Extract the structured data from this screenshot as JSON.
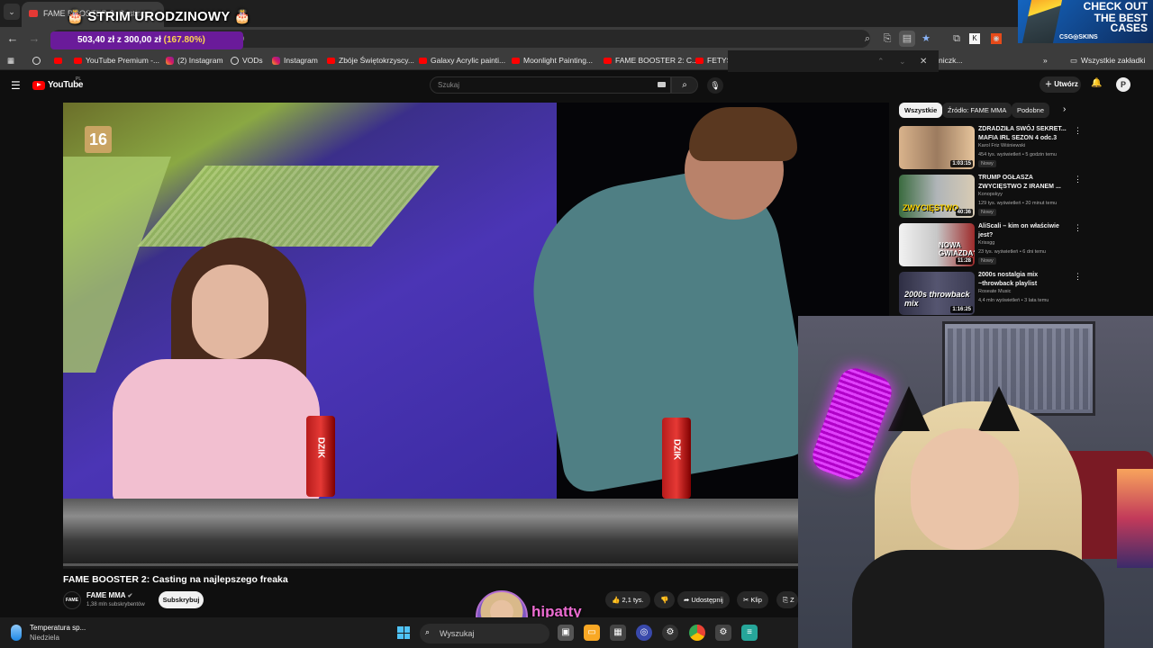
{
  "browser": {
    "active_tab_title": "FAME BOOSTER 2: Casting",
    "bookmarks": [
      {
        "label": "YouTube Premium -...",
        "icon": "youtube-icon"
      },
      {
        "label": "(2) Instagram",
        "icon": "instagram-icon"
      },
      {
        "label": "VODs",
        "icon": "globe-icon"
      },
      {
        "label": "Instagram",
        "icon": "instagram-icon"
      },
      {
        "label": "Zbóje Świętokrzyscy...",
        "icon": "youtube-icon"
      },
      {
        "label": "Galaxy Acrylic painti...",
        "icon": "youtube-icon"
      },
      {
        "label": "Moonlight Painting...",
        "icon": "youtube-icon"
      },
      {
        "label": "FAME BOOSTER 2: C...",
        "icon": "youtube-icon"
      },
      {
        "label": "FETYS",
        "icon": "youtube-icon"
      }
    ],
    "bookmark_partial_right": "niczk...",
    "all_bookmarks_label": "Wszystkie zakładki",
    "url_fragment": "0"
  },
  "stream_overlay": {
    "title": "🎂 STRIM URODZINOWY 🎂",
    "donation_current": "503,40 zł",
    "donation_sep": " z ",
    "donation_goal": "300,00 zł",
    "donation_pct": "(167.80%)",
    "ad_line1": "CHECK OUT",
    "ad_line2": "THE BEST",
    "ad_line3": "CASES",
    "ad_brand": "CSG◎SKINS",
    "streamer_name": "hipatty"
  },
  "youtube": {
    "logo_text": "YouTube",
    "region": "PL",
    "search_placeholder": "Szukaj",
    "create_label": "Utwórz",
    "avatar_letter": "P"
  },
  "video": {
    "rating_badge": "16",
    "can_label": "DZIK",
    "progress": 0.0,
    "title": "FAME BOOSTER 2: Casting na najlepszego freaka",
    "channel_name": "FAME MMA",
    "channel_logo": "FAME",
    "subscribers": "1,38 mln subskrybentów",
    "subscribe_label": "Subskrybuj",
    "likes": "2,1 tys.",
    "share_label": "Udostępnij",
    "clip_label": "Klip",
    "partial_label": "Z"
  },
  "sidebar": {
    "chips": [
      "Wszystkie",
      "Źródło: FAME MMA",
      "Podobne"
    ],
    "recommendations": [
      {
        "title": "ZDRADZIŁA SWÓJ SEKRET... MAFIA IRL SEZON 4 odc.3",
        "channel": "Karol Friz Wiśniewski",
        "meta": "454 tys. wyświetleń • 5 godzin temu",
        "badge": "Nowy",
        "duration": "1:03:15"
      },
      {
        "title": "TRUMP OGŁASZA ZWYCIĘSTWO Z IRANEM ...",
        "channel": "Konopskyy",
        "meta": "129 tys. wyświetleń • 20 minut temu",
        "badge": "Nowy",
        "duration": "40:36",
        "thumb_text": "ZWYCIĘSTWO"
      },
      {
        "title": "AliScali – kim on właściwie jest?",
        "channel": "Krissgg",
        "meta": "23 tys. wyświetleń • 6 dni temu",
        "badge": "Nowy",
        "duration": "11:28",
        "thumb_text": "NOWA GWIAZDA?"
      },
      {
        "title": "2000s nostalgia mix ~throwback playlist",
        "channel": "Roseate Music",
        "meta": "4,4 mln wyświetleń • 3 lata temu",
        "badge": "",
        "duration": "1:16:25",
        "thumb_text": "2000s throwback mix"
      }
    ]
  },
  "taskbar": {
    "weather_line1": "Temperatura sp...",
    "weather_line2": "Niedziela",
    "search_label": "Wyszukaj"
  },
  "colors": {
    "youtube_red": "#ff0000",
    "donation_bg": "#6a1b9a",
    "streamer_pink": "#ec6cd1"
  }
}
